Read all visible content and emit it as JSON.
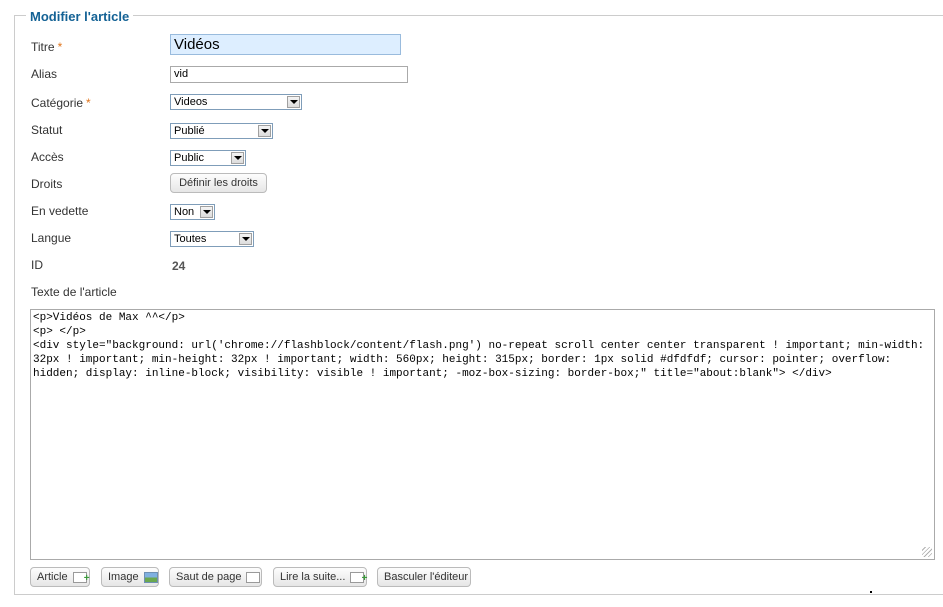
{
  "legend": "Modifier l'article",
  "fields": {
    "titre": {
      "label": "Titre",
      "required_mark": "*",
      "value": "Vidéos"
    },
    "alias": {
      "label": "Alias",
      "value": "vid"
    },
    "categorie": {
      "label": "Catégorie",
      "required_mark": "*",
      "value": "Videos"
    },
    "statut": {
      "label": "Statut",
      "value": "Publié"
    },
    "acces": {
      "label": "Accès",
      "value": "Public"
    },
    "droits": {
      "label": "Droits",
      "button": "Définir les droits"
    },
    "vedette": {
      "label": "En vedette",
      "value": "Non"
    },
    "langue": {
      "label": "Langue",
      "value": "Toutes"
    },
    "id": {
      "label": "ID",
      "value": "24"
    },
    "texte": {
      "label": "Texte de l'article"
    }
  },
  "editor": {
    "content": "<p>Vidéos de Max ^^</p>\n<p> </p>\n<div style=\"background: url('chrome://flashblock/content/flash.png') no-repeat scroll center center transparent ! important; min-width: 32px ! important; min-height: 32px ! important; width: 560px; height: 315px; border: 1px solid #dfdfdf; cursor: pointer; overflow: hidden; display: inline-block; visibility: visible ! important; -moz-box-sizing: border-box;\" title=\"about:blank\"> </div>"
  },
  "toolbar": {
    "article": "Article",
    "image": "Image",
    "saut": "Saut de page",
    "lire": "Lire la suite...",
    "basculer": "Basculer l'éditeur"
  },
  "colors": {
    "legend": "#146295",
    "required": "#e0751c",
    "focus_bg": "#ddeeff"
  }
}
